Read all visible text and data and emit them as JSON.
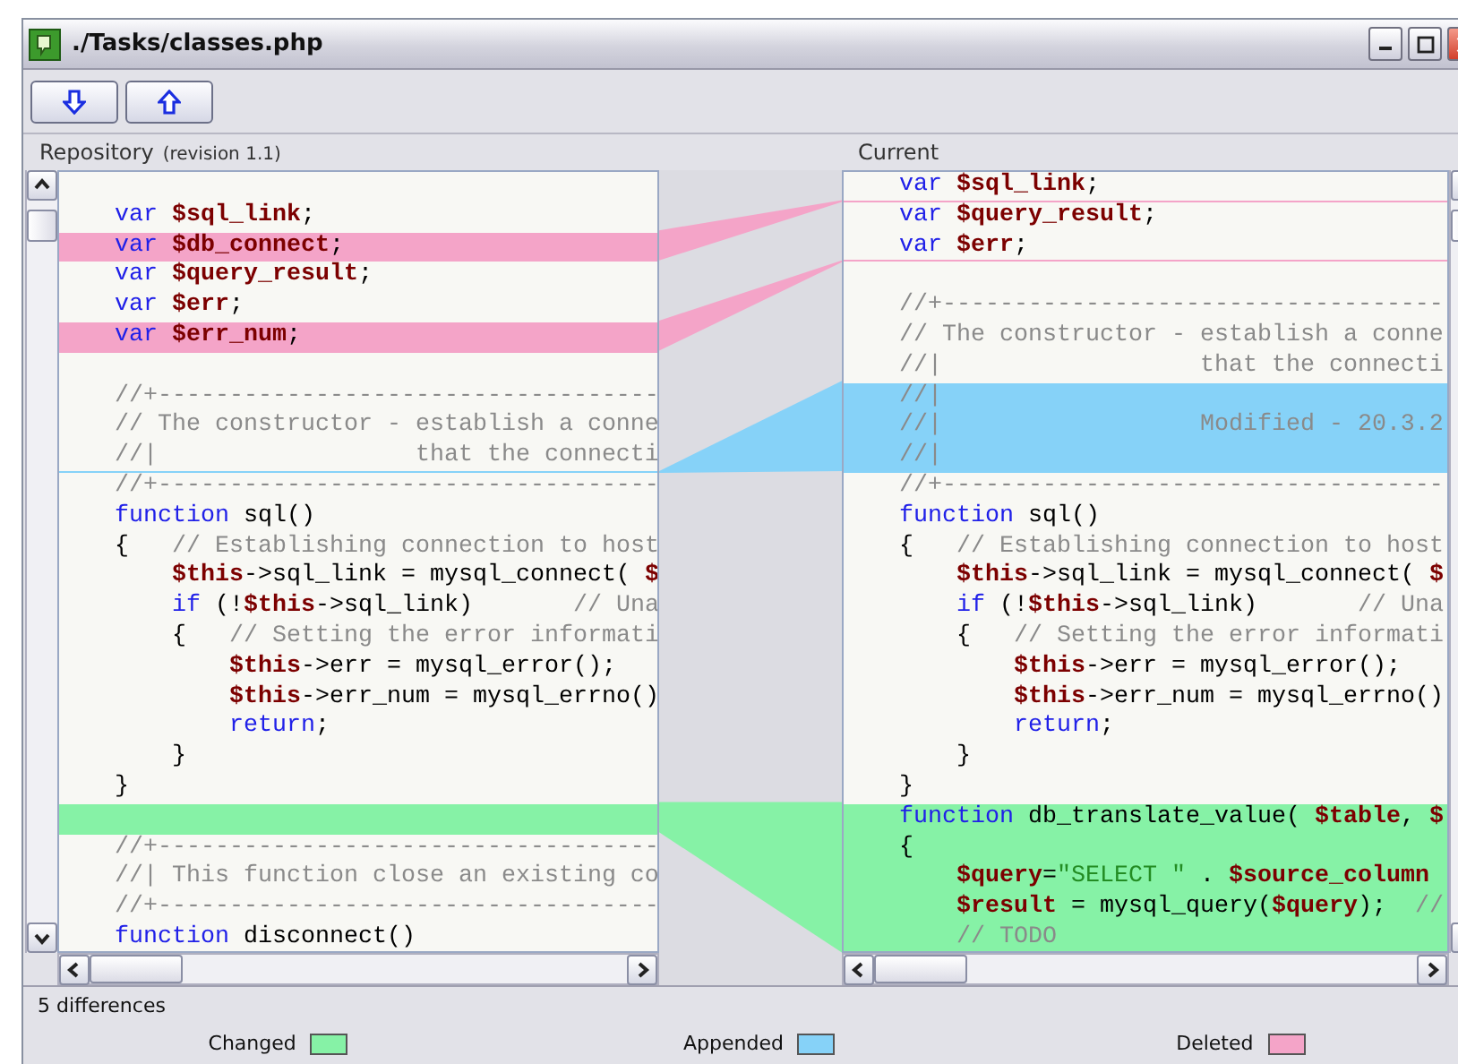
{
  "window": {
    "title": "./Tasks/classes.php"
  },
  "toolbar": {
    "buttons": [
      {
        "kind": "down"
      },
      {
        "kind": "up"
      }
    ]
  },
  "left": {
    "title": "Repository",
    "subtitle": "(revision 1.1)",
    "lines": [
      {
        "kind": "plain"
      },
      {
        "kind": "plain",
        "tokens": [
          {
            "kind": "kw",
            "text": "var "
          },
          {
            "kind": "var",
            "text": "$sql_link"
          },
          {
            "kind": "plain",
            "text": ";"
          }
        ]
      },
      {
        "kind": "deleted",
        "tokens": [
          {
            "kind": "kw",
            "text": "var "
          },
          {
            "kind": "var",
            "text": "$db_connect"
          },
          {
            "kind": "plain",
            "text": ";"
          }
        ]
      },
      {
        "kind": "plain",
        "tokens": [
          {
            "kind": "kw",
            "text": "var "
          },
          {
            "kind": "var",
            "text": "$query_result"
          },
          {
            "kind": "plain",
            "text": ";"
          }
        ]
      },
      {
        "kind": "plain",
        "tokens": [
          {
            "kind": "kw",
            "text": "var "
          },
          {
            "kind": "var",
            "text": "$err"
          },
          {
            "kind": "plain",
            "text": ";"
          }
        ]
      },
      {
        "kind": "deleted",
        "tokens": [
          {
            "kind": "kw",
            "text": "var "
          },
          {
            "kind": "var",
            "text": "$err_num"
          },
          {
            "kind": "plain",
            "text": ";"
          }
        ]
      },
      {
        "kind": "plain"
      },
      {
        "kind": "plain",
        "tokens": [
          {
            "kind": "comment",
            "text": "//+-----------------------------------"
          }
        ]
      },
      {
        "kind": "plain",
        "tokens": [
          {
            "kind": "comment",
            "text": "// The constructor - establish a conne"
          }
        ]
      },
      {
        "kind": "appended_gap",
        "tokens": [
          {
            "kind": "comment",
            "text": "//|                  that the connecti"
          }
        ]
      },
      {
        "kind": "plain",
        "tokens": [
          {
            "kind": "comment",
            "text": "//+-----------------------------------"
          }
        ]
      },
      {
        "kind": "plain",
        "tokens": [
          {
            "kind": "kw",
            "text": "function "
          },
          {
            "kind": "plain",
            "text": "sql()"
          }
        ]
      },
      {
        "kind": "plain",
        "tokens": [
          {
            "kind": "plain",
            "text": "{   "
          },
          {
            "kind": "comment",
            "text": "// Establishing connection to host"
          }
        ]
      },
      {
        "kind": "plain",
        "tokens": [
          {
            "kind": "var",
            "text": "    $this"
          },
          {
            "kind": "plain",
            "text": "->sql_link = mysql_connect( "
          },
          {
            "kind": "var",
            "text": "$"
          }
        ]
      },
      {
        "kind": "plain",
        "tokens": [
          {
            "kind": "kw",
            "text": "    if "
          },
          {
            "kind": "plain",
            "text": "(!"
          },
          {
            "kind": "var",
            "text": "$this"
          },
          {
            "kind": "plain",
            "text": "->sql_link)       "
          },
          {
            "kind": "comment",
            "text": "// Una"
          }
        ]
      },
      {
        "kind": "plain",
        "tokens": [
          {
            "kind": "plain",
            "text": "    {   "
          },
          {
            "kind": "comment",
            "text": "// Setting the error informati"
          }
        ]
      },
      {
        "kind": "plain",
        "tokens": [
          {
            "kind": "var",
            "text": "        $this"
          },
          {
            "kind": "plain",
            "text": "->err = mysql_error();"
          }
        ]
      },
      {
        "kind": "plain",
        "tokens": [
          {
            "kind": "var",
            "text": "        $this"
          },
          {
            "kind": "plain",
            "text": "->err_num = mysql_errno()"
          }
        ]
      },
      {
        "kind": "plain",
        "tokens": [
          {
            "kind": "kw",
            "text": "        return"
          },
          {
            "kind": "plain",
            "text": ";"
          }
        ]
      },
      {
        "kind": "plain",
        "tokens": [
          {
            "kind": "plain",
            "text": "    }"
          }
        ]
      },
      {
        "kind": "plain",
        "tokens": [
          {
            "kind": "plain",
            "text": "}"
          }
        ]
      },
      {
        "kind": "changed"
      },
      {
        "kind": "plain",
        "tokens": [
          {
            "kind": "comment",
            "text": "//+-----------------------------------"
          }
        ]
      },
      {
        "kind": "plain",
        "tokens": [
          {
            "kind": "comment",
            "text": "//| This function close an existing co"
          }
        ]
      },
      {
        "kind": "plain",
        "tokens": [
          {
            "kind": "comment",
            "text": "//+-----------------------------------"
          }
        ]
      },
      {
        "kind": "plain",
        "tokens": [
          {
            "kind": "kw",
            "text": "function "
          },
          {
            "kind": "plain",
            "text": "disconnect()"
          }
        ]
      }
    ]
  },
  "right": {
    "title": "Current",
    "lines": [
      {
        "kind": "deleted_gap",
        "tokens": [
          {
            "kind": "kw",
            "text": "var "
          },
          {
            "kind": "var",
            "text": "$sql_link"
          },
          {
            "kind": "plain",
            "text": ";"
          }
        ]
      },
      {
        "kind": "plain",
        "tokens": [
          {
            "kind": "kw",
            "text": "var "
          },
          {
            "kind": "var",
            "text": "$query_result"
          },
          {
            "kind": "plain",
            "text": ";"
          }
        ]
      },
      {
        "kind": "deleted_gap",
        "tokens": [
          {
            "kind": "kw",
            "text": "var "
          },
          {
            "kind": "var",
            "text": "$err"
          },
          {
            "kind": "plain",
            "text": ";"
          }
        ]
      },
      {
        "kind": "plain"
      },
      {
        "kind": "plain",
        "tokens": [
          {
            "kind": "comment",
            "text": "//+-----------------------------------"
          }
        ]
      },
      {
        "kind": "plain",
        "tokens": [
          {
            "kind": "comment",
            "text": "// The constructor - establish a conne"
          }
        ]
      },
      {
        "kind": "plain",
        "tokens": [
          {
            "kind": "comment",
            "text": "//|                  that the connecti"
          }
        ]
      },
      {
        "kind": "appended",
        "tokens": [
          {
            "kind": "comment",
            "text": "//|"
          }
        ]
      },
      {
        "kind": "appended",
        "tokens": [
          {
            "kind": "comment",
            "text": "//|                  Modified - 20.3.2"
          }
        ]
      },
      {
        "kind": "appended",
        "tokens": [
          {
            "kind": "comment",
            "text": "//|"
          }
        ]
      },
      {
        "kind": "plain",
        "tokens": [
          {
            "kind": "comment",
            "text": "//+-----------------------------------"
          }
        ]
      },
      {
        "kind": "plain",
        "tokens": [
          {
            "kind": "kw",
            "text": "function "
          },
          {
            "kind": "plain",
            "text": "sql()"
          }
        ]
      },
      {
        "kind": "plain",
        "tokens": [
          {
            "kind": "plain",
            "text": "{   "
          },
          {
            "kind": "comment",
            "text": "// Establishing connection to host"
          }
        ]
      },
      {
        "kind": "plain",
        "tokens": [
          {
            "kind": "var",
            "text": "    $this"
          },
          {
            "kind": "plain",
            "text": "->sql_link = mysql_connect( "
          },
          {
            "kind": "var",
            "text": "$"
          }
        ]
      },
      {
        "kind": "plain",
        "tokens": [
          {
            "kind": "kw",
            "text": "    if "
          },
          {
            "kind": "plain",
            "text": "(!"
          },
          {
            "kind": "var",
            "text": "$this"
          },
          {
            "kind": "plain",
            "text": "->sql_link)       "
          },
          {
            "kind": "comment",
            "text": "// Una"
          }
        ]
      },
      {
        "kind": "plain",
        "tokens": [
          {
            "kind": "plain",
            "text": "    {   "
          },
          {
            "kind": "comment",
            "text": "// Setting the error informati"
          }
        ]
      },
      {
        "kind": "plain",
        "tokens": [
          {
            "kind": "var",
            "text": "        $this"
          },
          {
            "kind": "plain",
            "text": "->err = mysql_error();"
          }
        ]
      },
      {
        "kind": "plain",
        "tokens": [
          {
            "kind": "var",
            "text": "        $this"
          },
          {
            "kind": "plain",
            "text": "->err_num = mysql_errno()"
          }
        ]
      },
      {
        "kind": "plain",
        "tokens": [
          {
            "kind": "kw",
            "text": "        return"
          },
          {
            "kind": "plain",
            "text": ";"
          }
        ]
      },
      {
        "kind": "plain",
        "tokens": [
          {
            "kind": "plain",
            "text": "    }"
          }
        ]
      },
      {
        "kind": "plain",
        "tokens": [
          {
            "kind": "plain",
            "text": "}"
          }
        ]
      },
      {
        "kind": "changed",
        "tokens": [
          {
            "kind": "kw",
            "text": "function "
          },
          {
            "kind": "plain",
            "text": "db_translate_value( "
          },
          {
            "kind": "var",
            "text": "$table"
          },
          {
            "kind": "plain",
            "text": ", "
          },
          {
            "kind": "var",
            "text": "$"
          }
        ]
      },
      {
        "kind": "changed",
        "tokens": [
          {
            "kind": "plain",
            "text": "{"
          }
        ]
      },
      {
        "kind": "changed",
        "tokens": [
          {
            "kind": "var",
            "text": "    $query"
          },
          {
            "kind": "plain",
            "text": "="
          },
          {
            "kind": "string",
            "text": "\"SELECT \""
          },
          {
            "kind": "plain",
            "text": " . "
          },
          {
            "kind": "var",
            "text": "$source_column"
          }
        ]
      },
      {
        "kind": "changed",
        "tokens": [
          {
            "kind": "var",
            "text": "    $result"
          },
          {
            "kind": "plain",
            "text": " = mysql_query("
          },
          {
            "kind": "var",
            "text": "$query"
          },
          {
            "kind": "plain",
            "text": ");  "
          },
          {
            "kind": "comment",
            "text": "//"
          }
        ]
      },
      {
        "kind": "changed",
        "tokens": [
          {
            "kind": "comment",
            "text": "    // TODO"
          }
        ]
      }
    ]
  },
  "status": {
    "summary": "5 differences"
  },
  "legend": [
    {
      "kind": "changed",
      "label": "Changed",
      "color": "#86f2a6"
    },
    {
      "kind": "appended",
      "label": "Appended",
      "color": "#86d2f8"
    },
    {
      "kind": "deleted",
      "label": "Deleted",
      "color": "#f4a4c8"
    }
  ]
}
